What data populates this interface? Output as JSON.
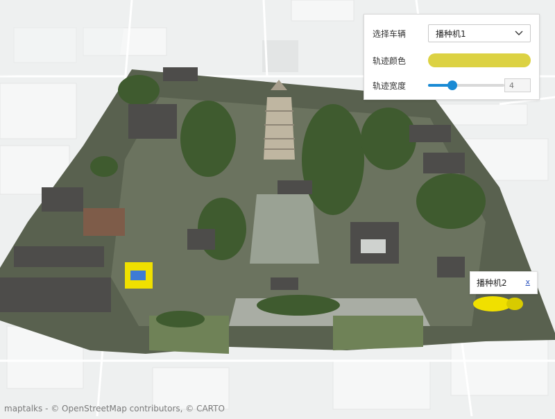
{
  "controls": {
    "vehicle_label": "选择车辆",
    "vehicle_value": "播种机1",
    "color_label": "轨迹颜色",
    "color_value": "#dcd243",
    "width_label": "轨迹宽度",
    "width_value": "4",
    "width_fraction": 0.32
  },
  "popup": {
    "title": "播种机2",
    "close_label": "x"
  },
  "attribution": "maptalks - © OpenStreetMap contributors, © CARTO",
  "icons": [
    "chevron-down-icon",
    "close-icon"
  ],
  "colors": {
    "accent": "#1a8ad4",
    "vehicle_yellow": "#f0e000",
    "vehicle_blue": "#3d7bd5"
  }
}
